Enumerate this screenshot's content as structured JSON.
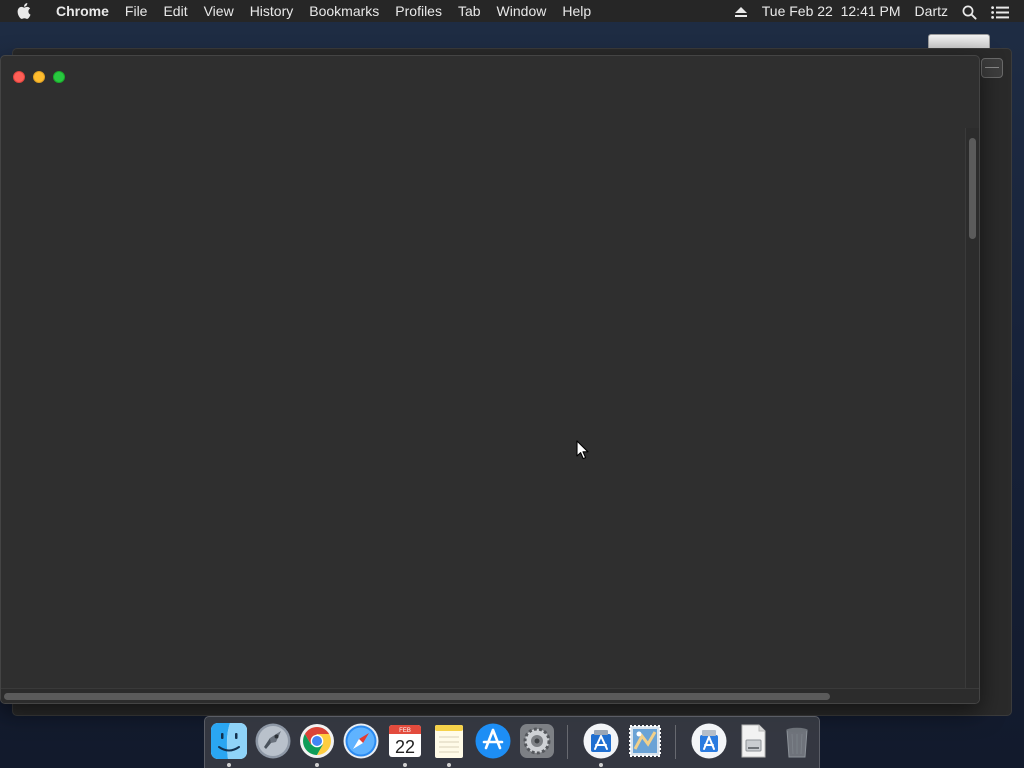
{
  "menubar": {
    "apple_icon": "apple-icon",
    "app_name": "Chrome",
    "menus": [
      "File",
      "Edit",
      "View",
      "History",
      "Bookmarks",
      "Profiles",
      "Tab",
      "Window",
      "Help"
    ],
    "eject_icon": "eject-icon",
    "clock": "Tue Feb 22  12:41 PM",
    "user": "Dartz",
    "search_icon": "spotlight-search-icon",
    "notification_icon": "notification-center-icon"
  },
  "windows": {
    "main": {
      "app": "Chrome",
      "background_color": "#2f2f2f",
      "traffic_lights": {
        "close": "#fe5f57",
        "minimize": "#febc2e",
        "zoom": "#28c840"
      }
    }
  },
  "dock": {
    "apps": [
      {
        "name": "finder-icon",
        "running": true
      },
      {
        "name": "launchpad-icon",
        "running": false
      },
      {
        "name": "chrome-icon",
        "running": true
      },
      {
        "name": "safari-icon",
        "running": false
      },
      {
        "name": "calendar-icon",
        "running": true,
        "calendar_month": "FEB",
        "calendar_day": "22"
      },
      {
        "name": "notes-icon",
        "running": true
      },
      {
        "name": "app-store-icon",
        "running": false
      },
      {
        "name": "system-preferences-icon",
        "running": false
      },
      {
        "name": "xcode-installer-icon",
        "running": true
      },
      {
        "name": "mail-stamp-icon",
        "running": false
      },
      {
        "name": "installer-package-icon",
        "running": false
      },
      {
        "name": "disk-image-icon",
        "running": false
      },
      {
        "name": "trash-icon",
        "running": false
      }
    ]
  }
}
